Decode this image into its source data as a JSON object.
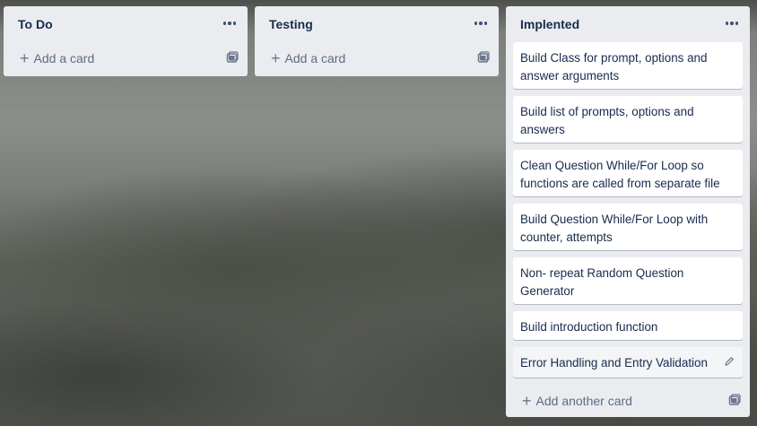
{
  "lists": [
    {
      "title": "To Do",
      "add_label": "Add a card",
      "cards": []
    },
    {
      "title": "Testing",
      "add_label": "Add a card",
      "cards": []
    },
    {
      "title": "Implented",
      "add_label": "Add another card",
      "cards": [
        "Build Class for prompt, options and answer arguments",
        "Build list of prompts, options and answers",
        "Clean Question While/For Loop so functions are called from separate file",
        "Build Question While/For Loop with counter, attempts",
        "Non- repeat Random Question Generator",
        "Build introduction function",
        "Error Handling and Entry Validation"
      ]
    }
  ],
  "icons": {
    "menu": "ellipsis-icon",
    "add": "plus-icon",
    "template": "card-template-icon",
    "edit": "pencil-icon"
  },
  "colors": {
    "list_bg": "#ebecf0",
    "card_bg": "#ffffff",
    "title_text": "#172b4d",
    "muted_text": "#5e6c84"
  }
}
